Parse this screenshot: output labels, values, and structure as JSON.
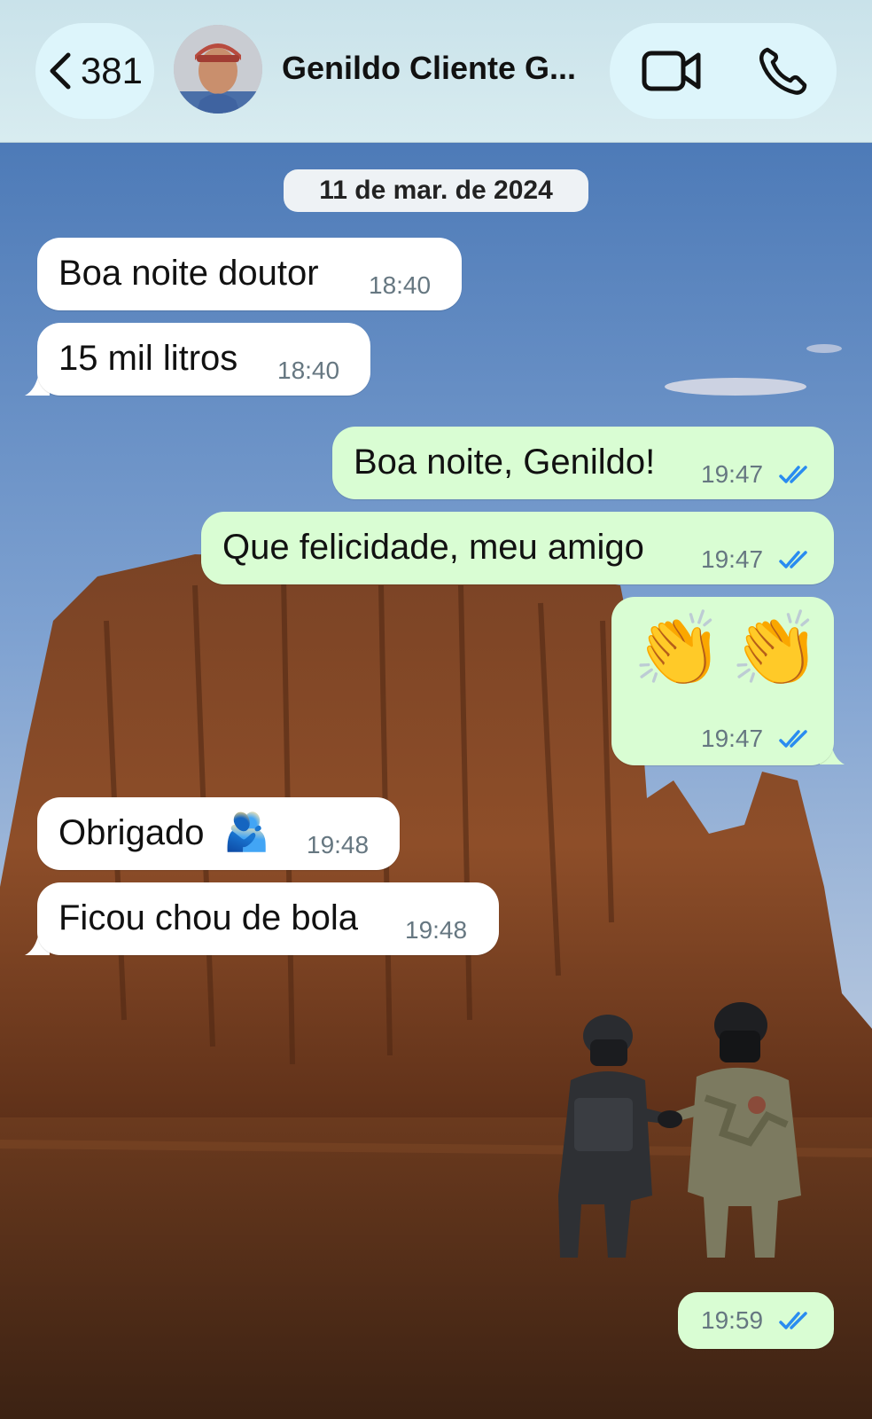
{
  "header": {
    "back_count": "381",
    "contact_name": "Genildo Cliente G..."
  },
  "chat": {
    "date": "11 de mar. de 2024",
    "messages": [
      {
        "text": "Boa noite doutor",
        "time": "18:40"
      },
      {
        "text": "15 mil litros",
        "time": "18:40"
      },
      {
        "text": "Boa noite, Genildo!",
        "time": "19:47"
      },
      {
        "text": "Que felicidade, meu amigo",
        "time": "19:47"
      },
      {
        "text": "👏👏",
        "time": "19:47"
      },
      {
        "text": "Obrigado",
        "emoji": "🫂",
        "time": "19:48"
      },
      {
        "text": "Ficou chou de bola",
        "time": "19:48"
      },
      {
        "time": "19:59"
      }
    ]
  },
  "colors": {
    "incoming": "#ffffff",
    "outgoing": "#d9fdd3",
    "read_ticks": "#2a8cf0",
    "header_bg": "#d8ecf0"
  },
  "icons": {
    "back": "chevron-left-icon",
    "video": "video-camera-icon",
    "phone": "phone-icon",
    "read": "double-check-icon"
  }
}
